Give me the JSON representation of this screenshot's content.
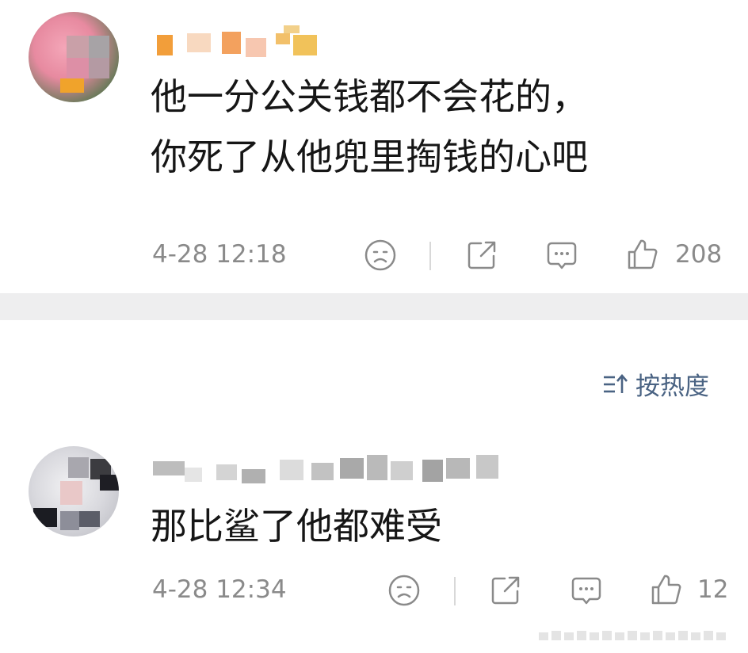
{
  "comments": [
    {
      "username": "",
      "text_line1": "他一分公关钱都不会花的，",
      "text_line2": "你死了从他兜里掏钱的心吧",
      "time": "4-28 12:18",
      "likes": "208"
    },
    {
      "username": "",
      "text_line1": "那比鲨了他都难受",
      "time": "4-28 12:34",
      "likes": "12"
    }
  ],
  "sort": {
    "label": "按热度"
  },
  "icons": {
    "dislike": "sad-face-icon",
    "share": "share-icon",
    "comment": "comment-bubble-icon",
    "like": "thumb-up-icon",
    "sort": "sort-icon"
  },
  "colors": {
    "text": "#161616",
    "meta": "#8a8a8a",
    "sort": "#4a6383",
    "band": "#eeeeef"
  }
}
